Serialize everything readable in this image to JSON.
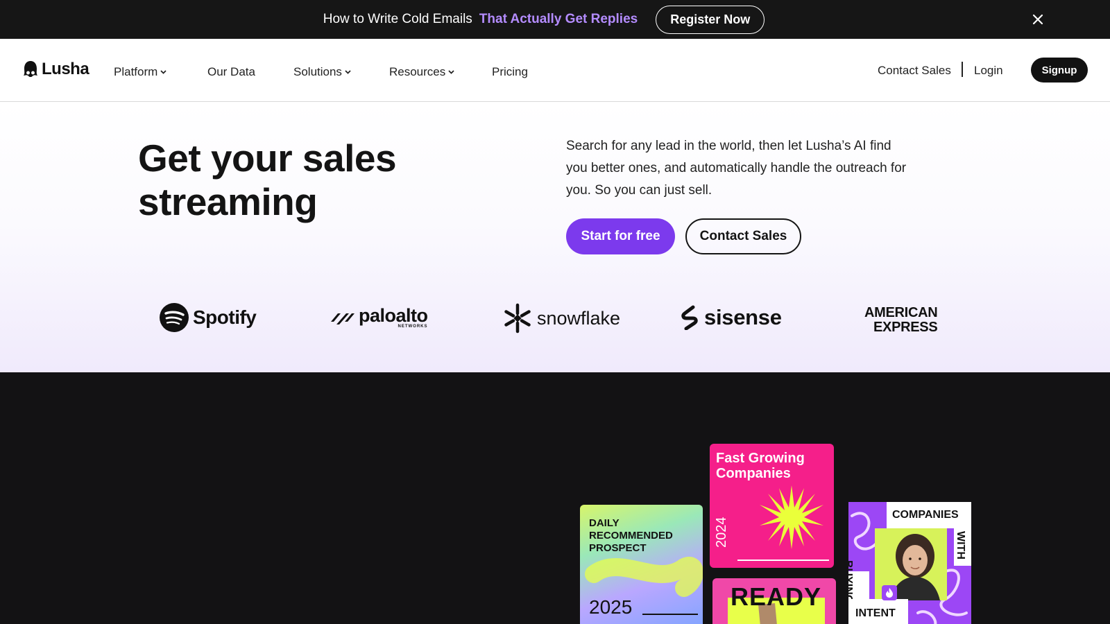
{
  "banner": {
    "text": "How to Write Cold Emails",
    "highlight": "That Actually Get Replies",
    "button": "Register Now",
    "close_icon": "close-icon"
  },
  "nav": {
    "logo": "Lusha",
    "items": [
      {
        "label": "Platform",
        "dropdown": true
      },
      {
        "label": "Our Data",
        "dropdown": false
      },
      {
        "label": "Solutions",
        "dropdown": true
      },
      {
        "label": "Resources",
        "dropdown": true
      },
      {
        "label": "Pricing",
        "dropdown": false
      }
    ],
    "contact_sales": "Contact Sales",
    "login": "Login",
    "signup": "Signup"
  },
  "hero": {
    "headline_line1": "Get your sales",
    "headline_line2": "streaming",
    "description": "Search for any lead in the world, then let Lusha’s AI find you better ones, and automatically handle the outreach for you. So you can just sell.",
    "primary_cta": "Start for free",
    "secondary_cta": "Contact Sales"
  },
  "logos": {
    "spotify": "Spotify",
    "paloalto": "paloalto",
    "paloalto_sub": "NETWORKS",
    "snowflake": "snowflake",
    "sisense": "sisense",
    "amex_line1": "AMERICAN",
    "amex_line2": "EXPRESS"
  },
  "cards": {
    "daily_label": "DAILY RECOMMENDED PROSPECT",
    "daily_year": "2025",
    "fast_title": "Fast Growing Companies",
    "fast_year": "2024",
    "ready_title": "READY",
    "intent_companies": "COMPANIES",
    "intent_with": "WITH",
    "intent_buying": "BUYING",
    "intent_intent": "INTENT"
  },
  "colors": {
    "accent": "#7c3aed",
    "banner_highlight": "#b48cff",
    "dark_bg": "#131214",
    "pink": "#f51f8a"
  }
}
